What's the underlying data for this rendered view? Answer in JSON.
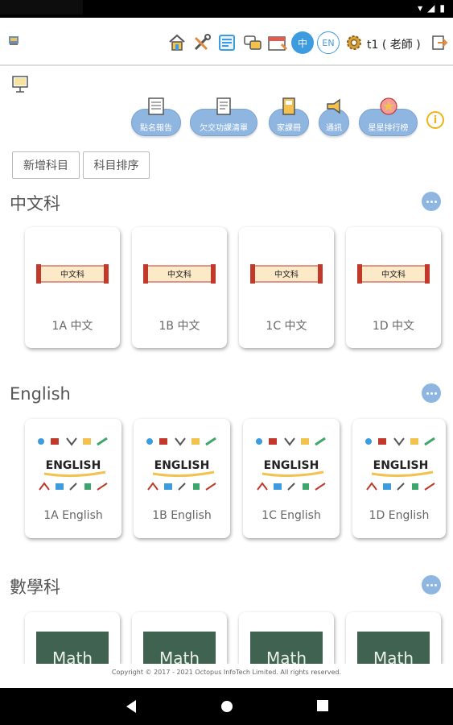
{
  "topbar": {
    "lang_zh": "中",
    "lang_en": "EN",
    "user": "t1 ( 老師 )"
  },
  "actions": [
    {
      "label": "點名報告",
      "icon": "attendance-icon"
    },
    {
      "label": "欠交功課清單",
      "icon": "homework-list-icon"
    },
    {
      "label": "家課冊",
      "icon": "homework-book-icon"
    },
    {
      "label": "通訊",
      "icon": "megaphone-icon"
    },
    {
      "label": "星星排行榜",
      "icon": "star-icon"
    }
  ],
  "buttons": {
    "add_subject": "新增科目",
    "sort_subject": "科目排序"
  },
  "sections": [
    {
      "title": "中文科",
      "cover_text": "中文科",
      "classes": [
        "1A 中文",
        "1B 中文",
        "1C 中文",
        "1D 中文"
      ]
    },
    {
      "title": "English",
      "cover_text": "ENGLISH",
      "classes": [
        "1A English",
        "1B English",
        "1C English",
        "1D English"
      ]
    },
    {
      "title": "數學科",
      "cover_text": "Math",
      "classes": []
    }
  ],
  "footer": "Copyright © 2017 - 2021 Octopus InfoTech Limited. All rights reserved.",
  "colors": {
    "accent": "#3d9be0",
    "pill": "#8fb6e0",
    "info": "#f0b21a",
    "scroll_red": "#c0392b",
    "chalkboard": "#3f6350"
  }
}
